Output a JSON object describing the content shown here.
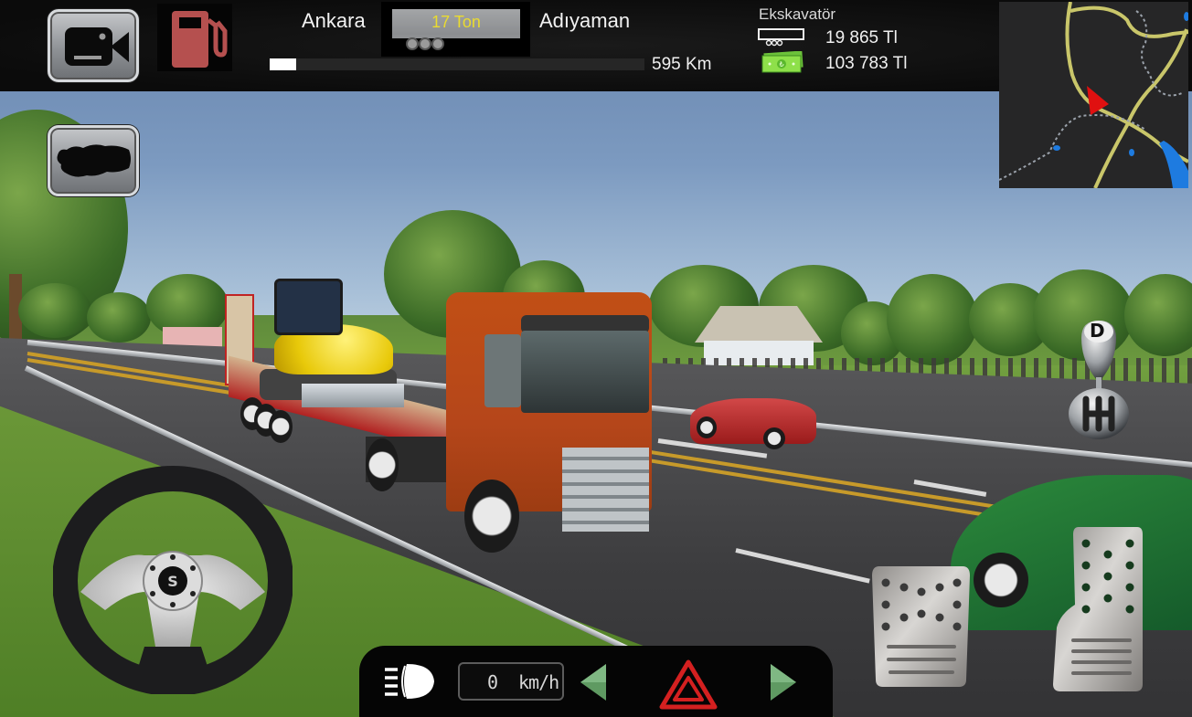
{
  "hud": {
    "camera_button": {
      "icon": "video-camera-icon"
    },
    "fuel_indicator": {
      "icon": "fuel-pump-icon",
      "color": "#b5504f"
    },
    "route": {
      "from": "Ankara",
      "to": "Adıyaman",
      "cargo_weight": "17 Ton",
      "distance": "595 Km",
      "progress_percent": 7
    },
    "cargo": {
      "name": "Ekskavatör",
      "payment": "19 865 Tl",
      "cash": "103 783 Tl"
    },
    "map_button": {
      "icon": "turkey-map-icon"
    },
    "minimap": {
      "player_marker_color": "#e01010",
      "road_color": "#c9c66a",
      "water_color": "#1e7be0"
    }
  },
  "controls": {
    "gear": "D",
    "speed_value": "0",
    "speed_unit": "km/h",
    "headlight_icon": "headlight-icon",
    "left_signal_icon": "left-arrow-icon",
    "hazard_icon": "hazard-triangle-icon",
    "right_signal_icon": "right-arrow-icon",
    "hazard_color": "#d42020",
    "signal_color": "#5f9a62"
  }
}
